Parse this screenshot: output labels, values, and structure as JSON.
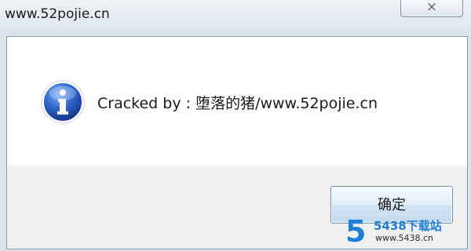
{
  "window": {
    "title": "www.52pojie.cn",
    "close_icon": "×"
  },
  "dialog": {
    "icon": "info-icon",
    "message": "Cracked by : 堕落的猪/www.52pojie.cn",
    "ok_label": "确定"
  },
  "watermark": {
    "logo": "5",
    "name": "5438下载站",
    "url": "www.5438.cn"
  },
  "colors": {
    "icon_blue": "#2f63c9",
    "button_border": "#6f8fb0",
    "watermark_blue": "#1e7fd6"
  }
}
